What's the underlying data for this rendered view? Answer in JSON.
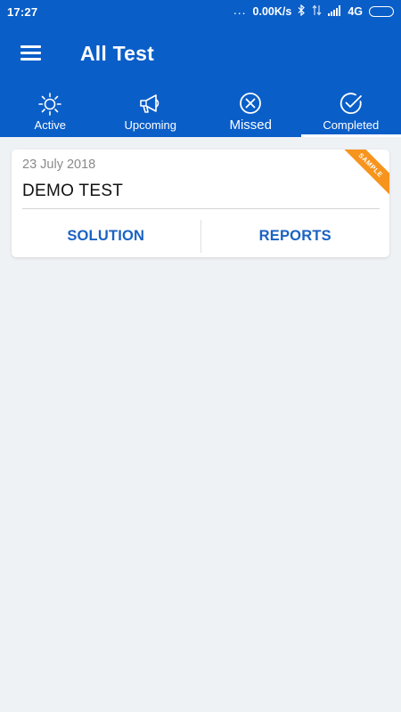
{
  "status_bar": {
    "time": "17:27",
    "dots": "...",
    "speed": "0.00K/s",
    "network": "4G"
  },
  "toolbar": {
    "title": "All Test",
    "menu_icon": "hamburger-menu-icon"
  },
  "tabs": [
    {
      "label": "Active",
      "icon": "sun-icon"
    },
    {
      "label": "Upcoming",
      "icon": "megaphone-icon"
    },
    {
      "label": "Missed",
      "icon": "close-circle-icon"
    },
    {
      "label": "Completed",
      "icon": "check-circle-icon",
      "selected": true
    }
  ],
  "card": {
    "date": "23 July 2018",
    "title": "DEMO TEST",
    "badge": "SAMPLE",
    "actions": {
      "solution": "SOLUTION",
      "reports": "REPORTS"
    }
  },
  "colors": {
    "primary": "#0a5ec8",
    "accent_text": "#1a62c4",
    "badge": "#f7941d",
    "background": "#eff2f5"
  }
}
